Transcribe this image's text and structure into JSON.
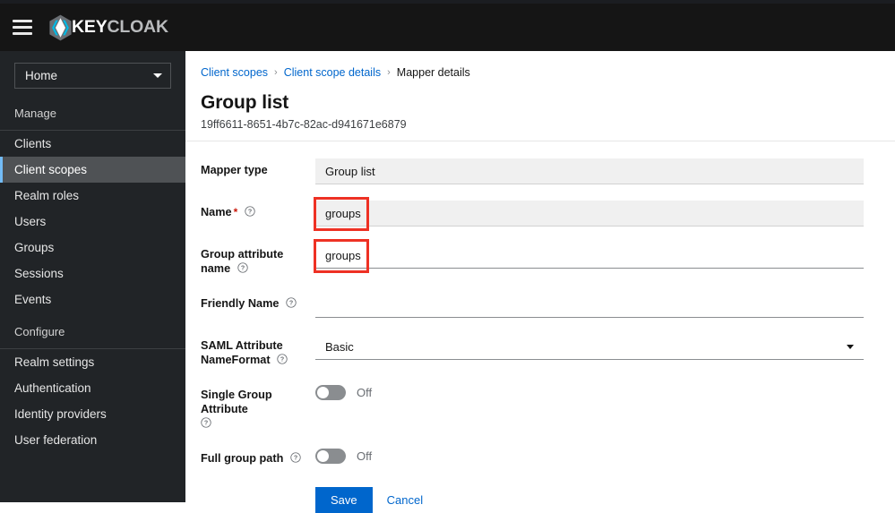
{
  "masthead": {
    "menu_icon": "hamburger-icon",
    "brand_primary": "KEY",
    "brand_secondary": "CLOAK",
    "logo_icon": "keycloak-logo-icon"
  },
  "sidebar": {
    "realm_selector": {
      "value": "Home",
      "caret_icon": "chevron-down-icon"
    },
    "sections": [
      {
        "title": "Manage",
        "items": [
          {
            "label": "Clients",
            "active": false
          },
          {
            "label": "Client scopes",
            "active": true
          },
          {
            "label": "Realm roles",
            "active": false
          },
          {
            "label": "Users",
            "active": false
          },
          {
            "label": "Groups",
            "active": false
          },
          {
            "label": "Sessions",
            "active": false
          },
          {
            "label": "Events",
            "active": false
          }
        ]
      },
      {
        "title": "Configure",
        "items": [
          {
            "label": "Realm settings",
            "active": false
          },
          {
            "label": "Authentication",
            "active": false
          },
          {
            "label": "Identity providers",
            "active": false
          },
          {
            "label": "User federation",
            "active": false
          }
        ]
      }
    ]
  },
  "breadcrumb": {
    "item1": "Client scopes",
    "sep1": "›",
    "item2": "Client scope details",
    "sep2": "›",
    "current": "Mapper details"
  },
  "page": {
    "title": "Group list",
    "subtitle": "19ff6611-8651-4b7c-82ac-d941671e6879"
  },
  "form": {
    "mapper_type": {
      "label": "Mapper type",
      "value": "Group list"
    },
    "name": {
      "label": "Name",
      "required_marker": "*",
      "help_icon": "help-circle-icon",
      "value": "groups"
    },
    "group_attribute_name": {
      "label": "Group attribute name",
      "help_icon": "help-circle-icon",
      "value": "groups"
    },
    "friendly_name": {
      "label": "Friendly Name",
      "help_icon": "help-circle-icon",
      "value": "",
      "placeholder": ""
    },
    "saml_attribute_nameformat": {
      "label_line1": "SAML Attribute",
      "label_line2": "NameFormat",
      "help_icon": "help-circle-icon",
      "value": "Basic",
      "caret_icon": "chevron-down-icon"
    },
    "single_group_attribute": {
      "label": "Single Group Attribute",
      "help_icon": "help-circle-icon",
      "state": "Off"
    },
    "full_group_path": {
      "label": "Full group path",
      "help_icon": "help-circle-icon",
      "state": "Off"
    }
  },
  "actions": {
    "save_label": "Save",
    "cancel_label": "Cancel"
  },
  "colors": {
    "accent_blue": "#0066cc",
    "link_blue": "#0066cc",
    "annotation_red": "#ee3124",
    "sidebar_bg": "#212427",
    "masthead_bg": "#151515",
    "active_item_bg": "#4f5255",
    "active_item_border": "#73bcf7"
  }
}
